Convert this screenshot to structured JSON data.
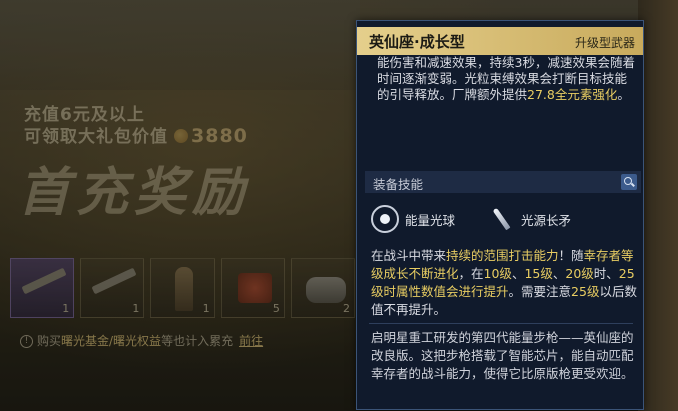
{
  "promo": {
    "line1": "充值6元及以上",
    "line2_prefix": "可领取大礼包价值",
    "line2_value": "3880",
    "big_title": "首充奖励",
    "rewards": [
      {
        "icon": "rifle-icon",
        "count": "1"
      },
      {
        "icon": "rifle-icon",
        "count": "1"
      },
      {
        "icon": "character-icon",
        "count": "1"
      },
      {
        "icon": "scroll-icon",
        "count": "5"
      },
      {
        "icon": "crate-icon",
        "count": "2"
      }
    ],
    "footer_prefix": "购买",
    "footer_highlight": "曙光基金/曙光权益",
    "footer_suffix": "等也计入累充",
    "footer_link": "前往"
  },
  "panel": {
    "title": "英仙座·成长型",
    "tag": "升级型武器",
    "desc_top": {
      "p1": "能伤害和减速效果，持续3秒，减速效果会随着时间逐渐变弱。光粒束缚效果会打断目标技能的引导释放。厂牌额外提供",
      "p1_gold": "27.8全元素强化",
      "p1_end": "。"
    },
    "skill_section": "装备技能",
    "skills": [
      {
        "label": "能量光球",
        "icon": "energy-orb-icon"
      },
      {
        "label": "光源长矛",
        "icon": "light-spear-icon"
      }
    ],
    "desc_mid": {
      "a": "在战斗中带来",
      "a_gold": "持续的范围打击能力",
      "b": "！随",
      "b_gold": "幸存者等级成长不断进化",
      "c": "，在",
      "c_gold1": "10级",
      "d": "、",
      "d_gold": "15级",
      "e": "、",
      "e_gold": "20级",
      "f": "时、",
      "f_gold": "25级",
      "g": "时属性数值会进行提升",
      "h": "。需要注意",
      "h_gold": "25级",
      "i": "以后数值不再提升。"
    },
    "lore": "启明星重工研发的第四代能量步枪——英仙座的改良版。这把步枪搭载了智能芯片，能自动匹配幸存者的战斗能力，使得它比原版枪更受欢迎。"
  }
}
